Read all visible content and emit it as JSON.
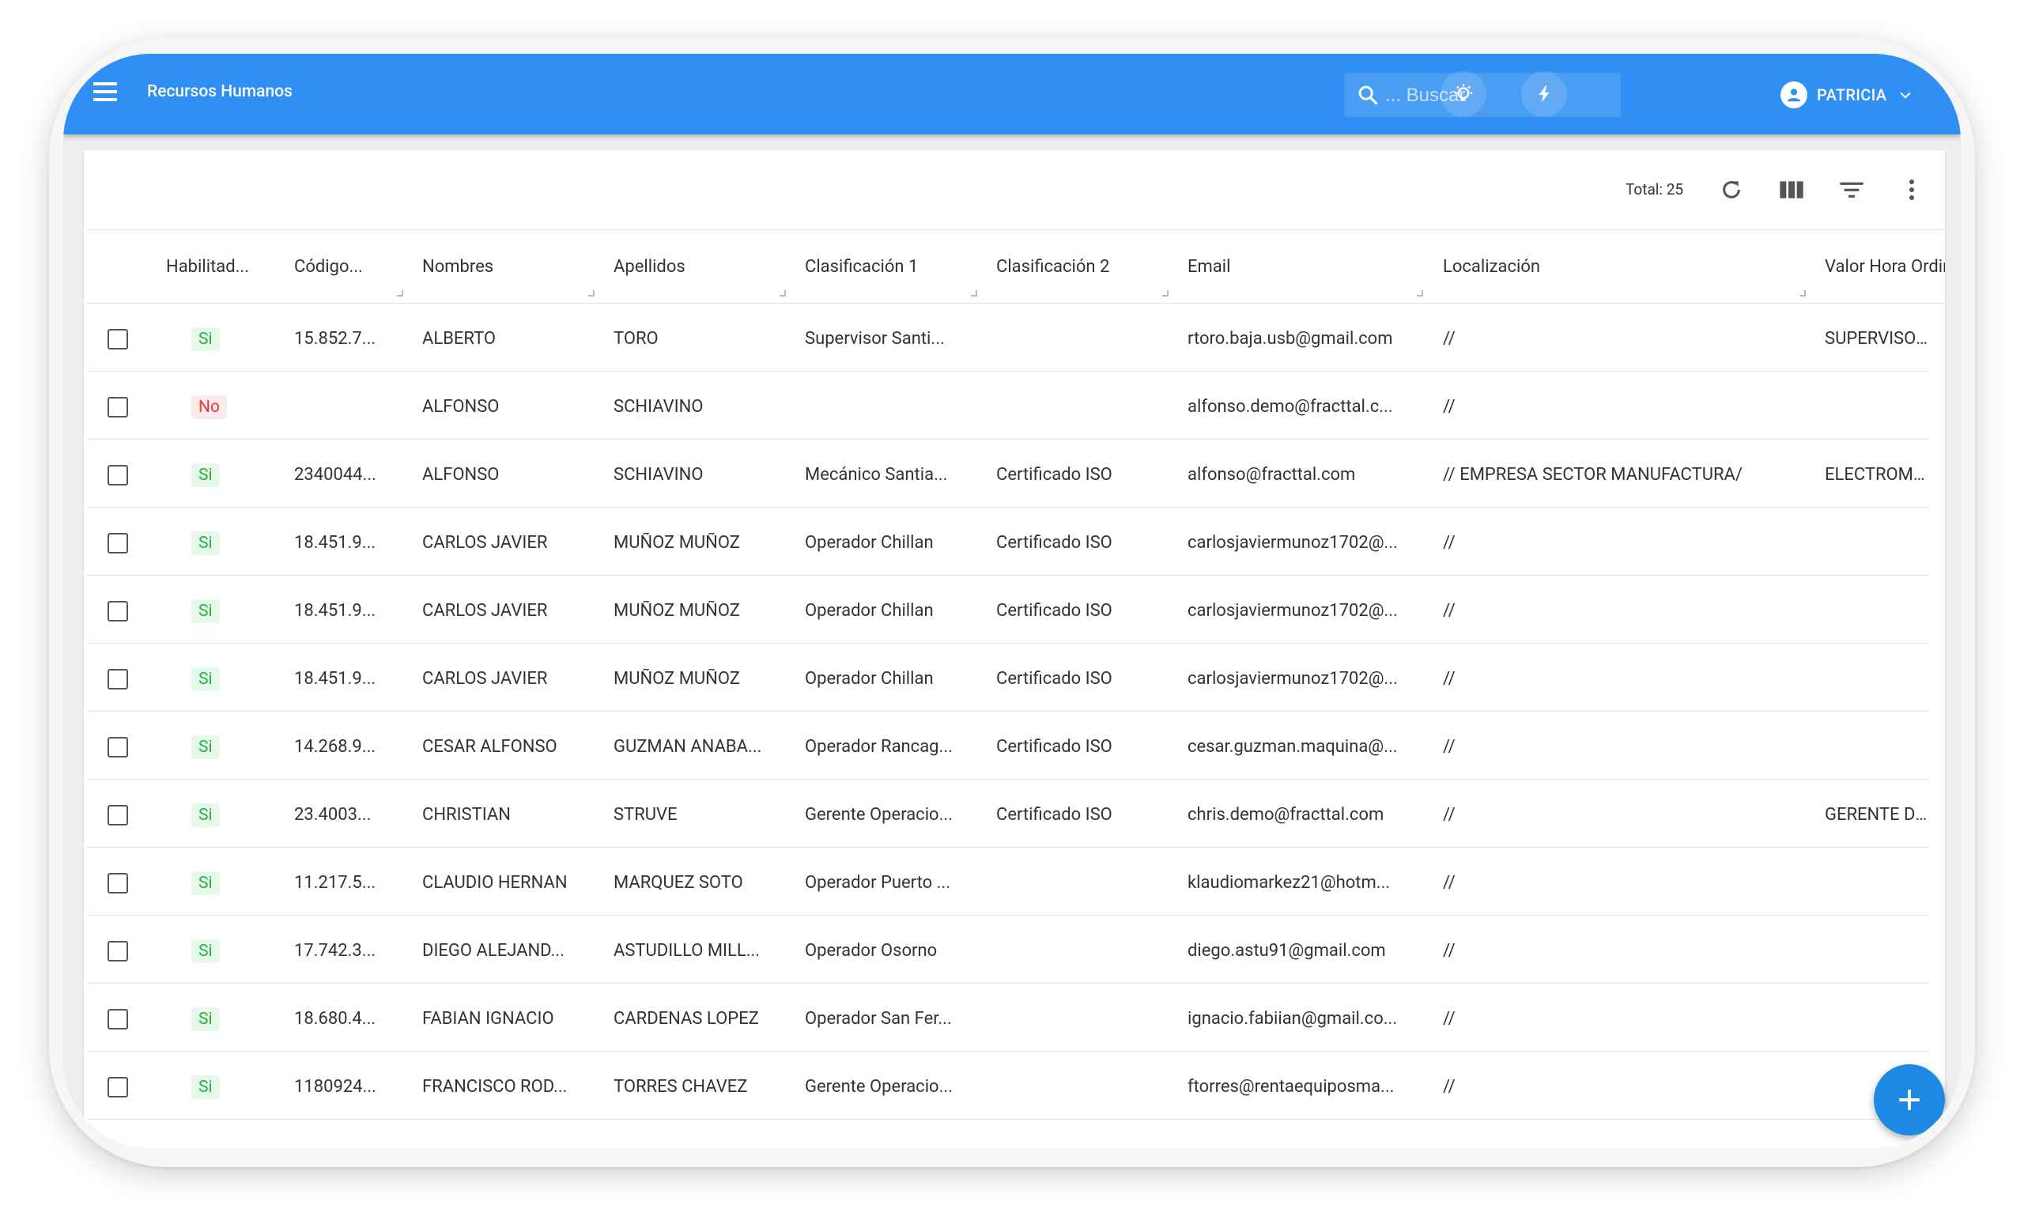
{
  "app": {
    "title": "Recursos Humanos"
  },
  "search": {
    "placeholder": "... Buscar"
  },
  "user": {
    "name": "PATRICIA"
  },
  "toolbar": {
    "total_label": "Total: 25"
  },
  "columns": [
    {
      "key": "habilitado",
      "label": "Habilitad..."
    },
    {
      "key": "codigo",
      "label": "Código..."
    },
    {
      "key": "nombres",
      "label": "Nombres"
    },
    {
      "key": "apellidos",
      "label": "Apellidos"
    },
    {
      "key": "clasif1",
      "label": "Clasificación 1"
    },
    {
      "key": "clasif2",
      "label": "Clasificación 2"
    },
    {
      "key": "email",
      "label": "Email"
    },
    {
      "key": "localizacion",
      "label": "Localización"
    },
    {
      "key": "valorhora",
      "label": "Valor Hora Ordinari"
    }
  ],
  "rows": [
    {
      "habilitado": "Si",
      "codigo": "15.852.7...",
      "nombres": "ALBERTO",
      "apellidos": "TORO",
      "clasif1": "Supervisor Santi...",
      "clasif2": "",
      "email": "rtoro.baja.usb@gmail.com",
      "localizacion": "//",
      "valorhora": "SUPERVISOR MEC"
    },
    {
      "habilitado": "No",
      "codigo": "",
      "nombres": "ALFONSO",
      "apellidos": "SCHIAVINO",
      "clasif1": "",
      "clasif2": "",
      "email": "alfonso.demo@fracttal.c...",
      "localizacion": "//",
      "valorhora": ""
    },
    {
      "habilitado": "Si",
      "codigo": "2340044...",
      "nombres": "ALFONSO",
      "apellidos": "SCHIAVINO",
      "clasif1": "Mecánico Santia...",
      "clasif2": "Certificado ISO",
      "email": "alfonso@fracttal.com",
      "localizacion": "// EMPRESA SECTOR MANUFACTURA/",
      "valorhora": "ELECTROMECANI"
    },
    {
      "habilitado": "Si",
      "codigo": "18.451.9...",
      "nombres": "CARLOS JAVIER",
      "apellidos": "MUÑOZ MUÑOZ",
      "clasif1": "Operador Chillan",
      "clasif2": "Certificado ISO",
      "email": "carlosjaviermunoz1702@...",
      "localizacion": "//",
      "valorhora": ""
    },
    {
      "habilitado": "Si",
      "codigo": "18.451.9...",
      "nombres": "CARLOS JAVIER",
      "apellidos": "MUÑOZ MUÑOZ",
      "clasif1": "Operador Chillan",
      "clasif2": "Certificado ISO",
      "email": "carlosjaviermunoz1702@...",
      "localizacion": "//",
      "valorhora": ""
    },
    {
      "habilitado": "Si",
      "codigo": "18.451.9...",
      "nombres": "CARLOS JAVIER",
      "apellidos": "MUÑOZ MUÑOZ",
      "clasif1": "Operador Chillan",
      "clasif2": "Certificado ISO",
      "email": "carlosjaviermunoz1702@...",
      "localizacion": "//",
      "valorhora": ""
    },
    {
      "habilitado": "Si",
      "codigo": "14.268.9...",
      "nombres": "CESAR ALFONSO",
      "apellidos": "GUZMAN ANABA...",
      "clasif1": "Operador Rancag...",
      "clasif2": "Certificado ISO",
      "email": "cesar.guzman.maquina@...",
      "localizacion": "//",
      "valorhora": ""
    },
    {
      "habilitado": "Si",
      "codigo": "23.4003...",
      "nombres": "CHRISTIAN",
      "apellidos": "STRUVE",
      "clasif1": "Gerente Operacio...",
      "clasif2": "Certificado ISO",
      "email": "chris.demo@fracttal.com",
      "localizacion": "//",
      "valorhora": "GERENTE DE OPE"
    },
    {
      "habilitado": "Si",
      "codigo": "11.217.5...",
      "nombres": "CLAUDIO HERNAN",
      "apellidos": "MARQUEZ SOTO",
      "clasif1": "Operador Puerto ...",
      "clasif2": "",
      "email": "klaudiomarkez21@hotm...",
      "localizacion": "//",
      "valorhora": ""
    },
    {
      "habilitado": "Si",
      "codigo": "17.742.3...",
      "nombres": "DIEGO ALEJAND...",
      "apellidos": "ASTUDILLO MILL...",
      "clasif1": "Operador Osorno",
      "clasif2": "",
      "email": "diego.astu91@gmail.com",
      "localizacion": "//",
      "valorhora": ""
    },
    {
      "habilitado": "Si",
      "codigo": "18.680.4...",
      "nombres": "FABIAN IGNACIO",
      "apellidos": "CARDENAS LOPEZ",
      "clasif1": "Operador San Fer...",
      "clasif2": "",
      "email": "ignacio.fabiian@gmail.co...",
      "localizacion": "//",
      "valorhora": ""
    },
    {
      "habilitado": "Si",
      "codigo": "1180924...",
      "nombres": "FRANCISCO ROD...",
      "apellidos": "TORRES CHAVEZ",
      "clasif1": "Gerente Operacio...",
      "clasif2": "",
      "email": "ftorres@rentaequiposma...",
      "localizacion": "//",
      "valorhora": ""
    },
    {
      "habilitado": "",
      "codigo": "",
      "nombres": "",
      "apellidos": "",
      "clasif1": "",
      "clasif2": "",
      "email": "",
      "localizacion": "",
      "valorhora": ""
    }
  ],
  "colors": {
    "topbar": "#2f8ff2",
    "fab": "#1e88e5",
    "badge_si": "#26b33e",
    "badge_no": "#e53935"
  },
  "icons": [
    "menu-icon",
    "search-icon",
    "lightbulb-icon",
    "flash-icon",
    "account-icon",
    "chevron-down-icon",
    "refresh-icon",
    "columns-icon",
    "filter-icon",
    "more-vert-icon",
    "add-icon"
  ]
}
